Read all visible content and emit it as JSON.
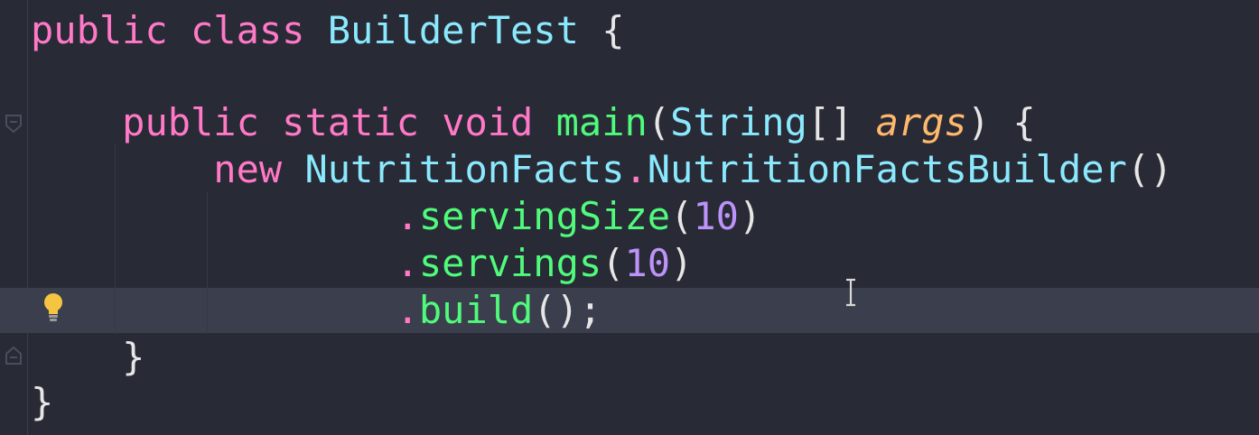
{
  "code": {
    "lines": [
      {
        "tokens": [
          {
            "text": "public",
            "kind": "kw"
          },
          {
            "text": " "
          },
          {
            "text": "class",
            "kind": "kw"
          },
          {
            "text": " "
          },
          {
            "text": "BuilderTest",
            "kind": "cls"
          },
          {
            "text": " {",
            "kind": "punc"
          }
        ]
      },
      {
        "tokens": []
      },
      {
        "tokens": [
          {
            "text": "    "
          },
          {
            "text": "public",
            "kind": "kw"
          },
          {
            "text": " "
          },
          {
            "text": "static",
            "kind": "kw"
          },
          {
            "text": " "
          },
          {
            "text": "void",
            "kind": "kw"
          },
          {
            "text": " "
          },
          {
            "text": "main",
            "kind": "fn"
          },
          {
            "text": "(",
            "kind": "punc"
          },
          {
            "text": "String",
            "kind": "cls"
          },
          {
            "text": "[] ",
            "kind": "punc"
          },
          {
            "text": "args",
            "kind": "param"
          },
          {
            "text": ") {",
            "kind": "punc"
          }
        ]
      },
      {
        "tokens": [
          {
            "text": "        "
          },
          {
            "text": "new",
            "kind": "kw"
          },
          {
            "text": " "
          },
          {
            "text": "NutritionFacts",
            "kind": "cls"
          },
          {
            "text": ".",
            "kind": "kw"
          },
          {
            "text": "NutritionFactsBuilder",
            "kind": "cls"
          },
          {
            "text": "()",
            "kind": "punc"
          }
        ]
      },
      {
        "tokens": [
          {
            "text": "                "
          },
          {
            "text": ".",
            "kind": "kw"
          },
          {
            "text": "servingSize",
            "kind": "fn"
          },
          {
            "text": "(",
            "kind": "punc"
          },
          {
            "text": "10",
            "kind": "num"
          },
          {
            "text": ")",
            "kind": "punc"
          }
        ]
      },
      {
        "tokens": [
          {
            "text": "                "
          },
          {
            "text": ".",
            "kind": "kw"
          },
          {
            "text": "servings",
            "kind": "fn"
          },
          {
            "text": "(",
            "kind": "punc"
          },
          {
            "text": "10",
            "kind": "num"
          },
          {
            "text": ")",
            "kind": "punc"
          }
        ]
      },
      {
        "tokens": [
          {
            "text": "                "
          },
          {
            "text": ".",
            "kind": "kw"
          },
          {
            "text": "build",
            "kind": "fn"
          },
          {
            "text": "();",
            "kind": "punc"
          }
        ]
      },
      {
        "tokens": [
          {
            "text": "    "
          },
          {
            "text": "}",
            "kind": "punc"
          }
        ]
      },
      {
        "tokens": [
          {
            "text": "}",
            "kind": "punc"
          }
        ]
      }
    ]
  },
  "icons": {
    "bulb": "lightbulb-icon",
    "fold": "fold-marker-icon",
    "cursor": "text-cursor-icon"
  },
  "colors": {
    "background": "#282a36",
    "current_line": "#3b3e4c",
    "keyword": "#ff79c6",
    "class": "#8be9fd",
    "function": "#50fa7b",
    "parameter": "#ffb86c",
    "number": "#bd93f9",
    "bulb": "#f5c542"
  }
}
